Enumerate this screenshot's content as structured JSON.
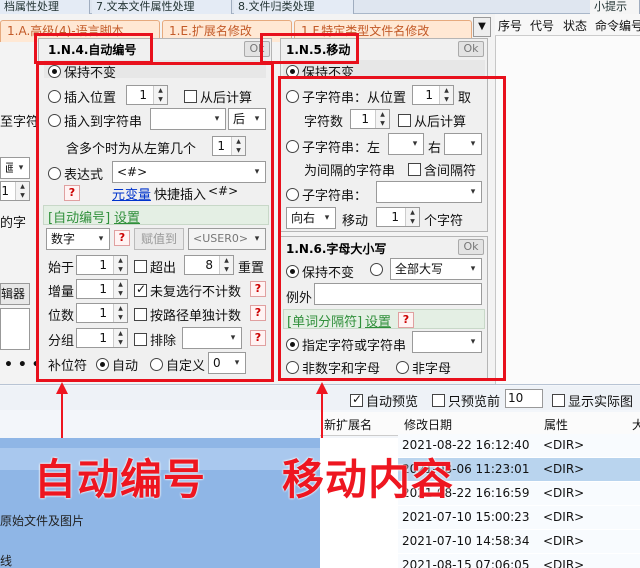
{
  "top_tabs": [
    "档属性处理",
    "7.文本文件属性处理",
    "8.文件归类处理",
    "小提示"
  ],
  "sub_tabs": [
    "1.A.高级(4)-语言脚本",
    "1.E.扩展名修改",
    "1.F.特定类型文件名修改"
  ],
  "right_columns": [
    "序号",
    "代号",
    "状态",
    "命令编号"
  ],
  "left_fragments": [
    "至字符",
    "画",
    "1",
    "的字",
    "辑器"
  ],
  "auto_number": {
    "title": "1.N.4.自动编号",
    "ok": "Ok",
    "keep": "保持不变",
    "insert_pos_label": "插入位置",
    "insert_pos_value": "1",
    "from_end": "从后计算",
    "insert_str_label": "插入到字符串",
    "insert_str_dir": "后",
    "multi_label": "含多个时为从左第几个",
    "multi_value": "1",
    "expr_label": "表达式",
    "expr_value": "<#>",
    "var_link": "元变量",
    "quick_insert": "快捷插入",
    "quick_val": "<#>",
    "section_bracket": "[自动编号]",
    "section_set": "设置",
    "type_value": "数字",
    "assign_btn": "赋值到",
    "user_value": "<USER0>",
    "start_label": "始于",
    "start_value": "1",
    "exceed_label": "超出",
    "exceed_value": "8",
    "reset_label": "重置",
    "step_label": "增量",
    "step_value": "1",
    "not_count_label": "未复选行不计数",
    "digits_label": "位数",
    "digits_value": "1",
    "by_path_label": "按路径单独计数",
    "group_label": "分组",
    "group_value": "1",
    "exclude_label": "排除",
    "pad_label": "补位符",
    "pad_auto": "自动",
    "pad_custom": "自定义",
    "pad_value": "0",
    "q": "?"
  },
  "move": {
    "title": "1.N.5.移动",
    "ok": "Ok",
    "keep": "保持不变",
    "sub_from_pos": "子字符串：从位置",
    "from_pos_value": "1",
    "take": "取",
    "count_label": "字符数",
    "count_value": "1",
    "from_end": "从后计算",
    "sub_left": "子字符串：左",
    "right": "右",
    "between": "为间隔的字符串",
    "include_sep": "含间隔符",
    "sub_str": "子字符串：",
    "dir_value": "向右",
    "move_label": "移动",
    "move_value": "1",
    "chars": "个字符"
  },
  "case": {
    "title": "1.N.6.字母大小写",
    "ok": "Ok",
    "keep": "保持不变",
    "mode_value": "全部大写",
    "exception": "例外",
    "section_bracket": "[单词分隔符]",
    "section_set": "设置",
    "q": "?",
    "sep_option": "指定字符或字符串",
    "non_alnum": "非数字和字母",
    "non_letter": "非字母"
  },
  "bottom": {
    "auto_preview": "自动预览",
    "preview_before": "只预览前",
    "preview_count": "10",
    "show_actual": "显示实际图标",
    "col_new_ext": "新扩展名",
    "col_date": "修改日期",
    "col_attr": "属性",
    "col_more": "大",
    "left_fragment_1": "原始文件及图片",
    "left_fragment_2": "线",
    "rows": [
      {
        "date": "2021-08-22 16:12:40",
        "attr": "<DIR>"
      },
      {
        "date": "2021-08-06 11:23:01",
        "attr": "<DIR>"
      },
      {
        "date": "2021-08-22 16:16:59",
        "attr": "<DIR>"
      },
      {
        "date": "2021-07-10 15:00:23",
        "attr": "<DIR>"
      },
      {
        "date": "2021-07-10 14:58:34",
        "attr": "<DIR>"
      },
      {
        "date": "2021-08-15 07:06:05",
        "attr": "<DIR>"
      }
    ]
  },
  "annotations": {
    "left": "自动编号",
    "right": "移动内容"
  },
  "colors": {
    "annotation_red": "#ee1620",
    "selected_row": "#b9d4ee",
    "blue_block": "#8fb6e6",
    "section_green": "#2f8f3a",
    "link_blue": "#0033cc"
  }
}
